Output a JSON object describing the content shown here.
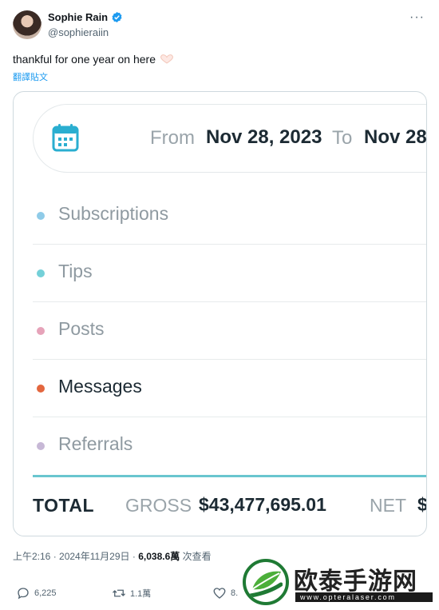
{
  "author": {
    "name": "Sophie Rain",
    "handle": "@sophieraiin",
    "avatar_icon": "profile-photo",
    "verified_icon": "verified-badge-icon"
  },
  "post": {
    "text": "thankful for one year on here",
    "emoji": "heart-hands",
    "translate_label": "翻譯貼文"
  },
  "earnings": {
    "from_label": "From",
    "from_date": "Nov 28, 2023",
    "to_label": "To",
    "to_date": "Nov 28,",
    "categories": [
      {
        "label": "Subscriptions",
        "color": "#8fcbe8",
        "muted": true
      },
      {
        "label": "Tips",
        "color": "#74d0d8",
        "muted": true
      },
      {
        "label": "Posts",
        "color": "#e6a3b9",
        "muted": true
      },
      {
        "label": "Messages",
        "color": "#e3663e",
        "muted": false
      },
      {
        "label": "Referrals",
        "color": "#c7b8d6",
        "muted": true
      }
    ],
    "total_label": "TOTAL",
    "gross_label": "GROSS",
    "gross_value": "$43,477,695.01",
    "net_label": "NET",
    "net_value": "$"
  },
  "meta": {
    "time": "上午2:16",
    "date": "2024年11月29日",
    "views": "6,038.6萬",
    "views_label": "次查看"
  },
  "actions": {
    "replies": "6,225",
    "reposts": "1.1萬",
    "likes": "8."
  },
  "watermark": {
    "title": "欧泰手游网",
    "url": "www.opteralaser.com",
    "brand_color": "#1f7a34"
  }
}
